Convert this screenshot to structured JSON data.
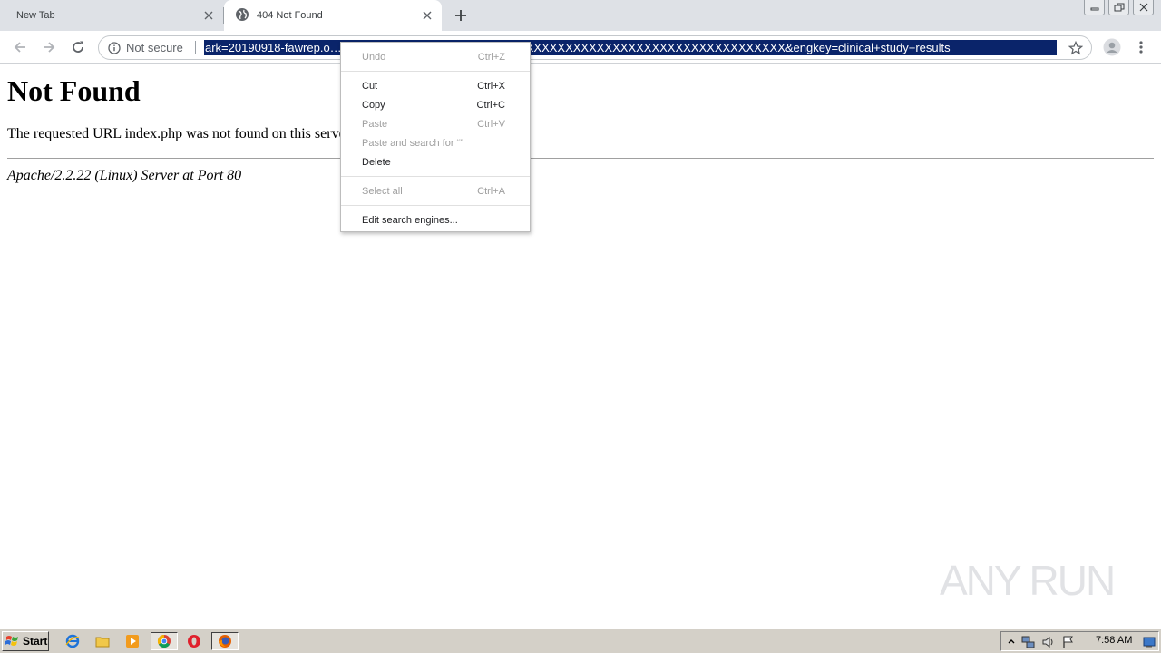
{
  "tabs": [
    {
      "title": "New Tab",
      "active": false
    },
    {
      "title": "404 Not Found",
      "active": true
    }
  ],
  "toolbar": {
    "security_label": "Not secure",
    "url": "ark=20190918-fawrep.o… XXXXXXXXXXXXXXXXXXXXXXXXXXXXXXXXXXXXXXXXXXXXXXXXXXXXXXXX&engkey=clinical+study+results"
  },
  "page": {
    "heading": "Not Found",
    "message": "The requested URL index.php was not found on this server.",
    "address": "Apache/2.2.22 (Linux) Server at Port 80"
  },
  "context_menu": {
    "items": [
      {
        "label": "Undo",
        "shortcut": "Ctrl+Z",
        "enabled": false
      },
      {
        "label": "Cut",
        "shortcut": "Ctrl+X",
        "enabled": true
      },
      {
        "label": "Copy",
        "shortcut": "Ctrl+C",
        "enabled": true
      },
      {
        "label": "Paste",
        "shortcut": "Ctrl+V",
        "enabled": false
      },
      {
        "label": "Paste and search for “”",
        "shortcut": "",
        "enabled": false
      },
      {
        "label": "Delete",
        "shortcut": "",
        "enabled": true
      },
      {
        "label": "Select all",
        "shortcut": "Ctrl+A",
        "enabled": false
      },
      {
        "label": "Edit search engines...",
        "shortcut": "",
        "enabled": true
      }
    ]
  },
  "watermark": {
    "text": "ANY RUN"
  },
  "taskbar": {
    "start_label": "Start",
    "clock": "7:58 AM"
  },
  "icons": {
    "back": "back-arrow-icon",
    "forward": "forward-arrow-icon",
    "reload": "reload-icon",
    "info": "info-icon",
    "star": "bookmark-star-icon",
    "profile": "profile-avatar-icon",
    "menu": "three-dot-menu-icon"
  },
  "colors": {
    "selection": "#0a246a",
    "tabstrip": "#dee1e6",
    "taskbar": "#d4d0c8"
  }
}
